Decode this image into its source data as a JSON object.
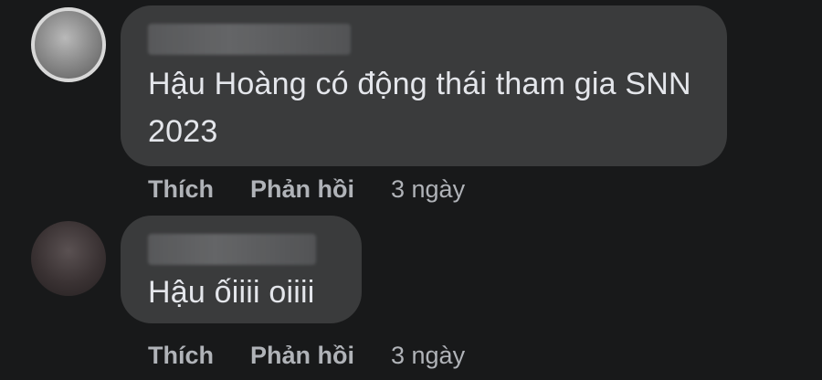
{
  "comments": [
    {
      "author": "",
      "text": "Hậu Hoàng có động thái tham gia SNN 2023",
      "actions": {
        "like": "Thích",
        "reply": "Phản hồi"
      },
      "time": "3 ngày"
    },
    {
      "author": "",
      "text": "Hậu ốiiii oiiii",
      "actions": {
        "like": "Thích",
        "reply": "Phản hồi"
      },
      "time": "3 ngày"
    }
  ],
  "colors": {
    "background": "#18191a",
    "bubble": "#3a3b3c",
    "text": "#e4e6eb",
    "secondary_text": "#b0b3b8"
  }
}
